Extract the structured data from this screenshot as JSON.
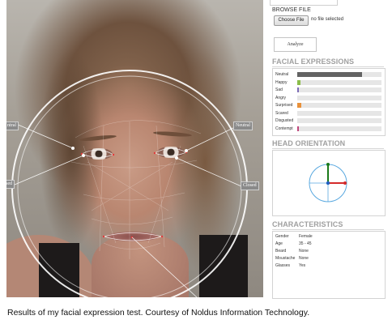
{
  "face_overlay": {
    "tags": [
      "Neutral",
      "Neutral",
      "Closed",
      "Closed"
    ],
    "tags_visible": [
      "ntral",
      "Neutral",
      "sed",
      "Closed"
    ]
  },
  "panel": {
    "browse_label": "BROWSE FILE",
    "choose_button": "Choose File",
    "no_file_text": "no file selected",
    "analyze_button": "Analyze"
  },
  "facial_expressions": {
    "title": "FACIAL EXPRESSIONS",
    "items": [
      {
        "label": "Neutral",
        "value": 0.77,
        "color": "#636363"
      },
      {
        "label": "Happy",
        "value": 0.04,
        "color": "#8bbd4a"
      },
      {
        "label": "Sad",
        "value": 0.01,
        "color": "#7d6db6"
      },
      {
        "label": "Angry",
        "value": 0.0,
        "color": "#cc3333"
      },
      {
        "label": "Surprised",
        "value": 0.05,
        "color": "#e8903a"
      },
      {
        "label": "Scared",
        "value": 0.0,
        "color": "#5a8ac6"
      },
      {
        "label": "Disgusted",
        "value": 0.0,
        "color": "#8b5a2b"
      },
      {
        "label": "Contempt",
        "value": 0.01,
        "color": "#c0477c"
      }
    ]
  },
  "head_orientation": {
    "title": "HEAD ORIENTATION",
    "axis_colors": {
      "up": "#1a7a1a",
      "right": "#d42a2a",
      "left": "#1e5fbf",
      "ring": "#5aa9e0"
    }
  },
  "characteristics": {
    "title": "CHARACTERISTICS",
    "rows": [
      {
        "key": "Gender",
        "value": "Female"
      },
      {
        "key": "Age",
        "value": "35 - 45"
      },
      {
        "key": "Beard",
        "value": "None"
      },
      {
        "key": "Moustache",
        "value": "None"
      },
      {
        "key": "Glasses",
        "value": "Yes"
      }
    ]
  },
  "caption": "Results of my facial expression test.  Courtesy of Noldus Information Technology."
}
